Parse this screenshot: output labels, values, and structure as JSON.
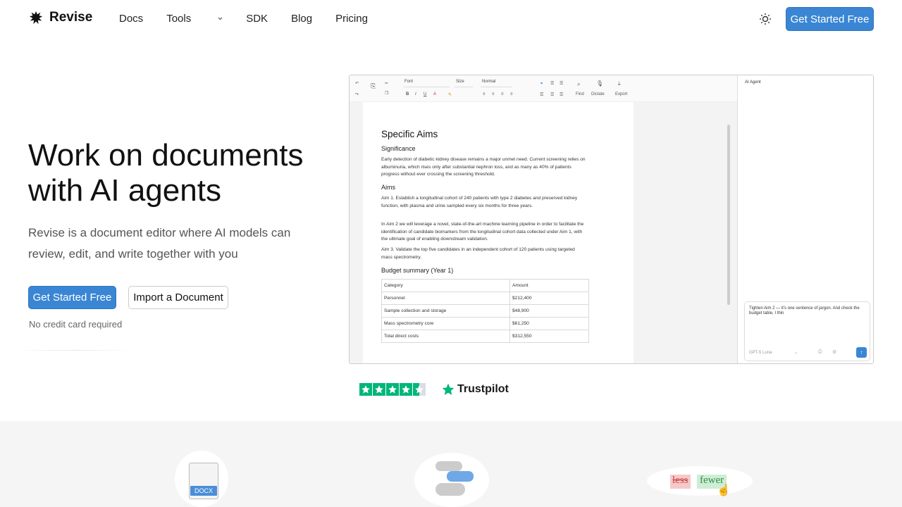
{
  "nav": {
    "brand": "Revise",
    "links": [
      "Docs",
      "Tools",
      "SDK",
      "Blog",
      "Pricing"
    ],
    "cta": "Get Started Free"
  },
  "hero": {
    "title": "Work on documents with AI agents",
    "subtitle": "Revise is a document editor where AI models can review, edit, and write together with you",
    "primary_cta": "Get Started Free",
    "secondary_cta": "Import a Document",
    "note": "No credit card required"
  },
  "editor": {
    "toolbar": {
      "font": "Font",
      "size": "Size",
      "style": "Normal",
      "find": "Find",
      "dictate": "Dictate",
      "export": "Export"
    },
    "doc": {
      "title": "Specific Aims",
      "significance_heading": "Significance",
      "significance_text": "Early detection of diabetic kidney disease remains a major unmet need. Current screening relies on albuminuria, which rises only after substantial nephron loss, and as many as 40% of patients progress without ever crossing the screening threshold.",
      "aims_heading": "Aims",
      "aim1": "Aim 1. Establish a longitudinal cohort of 240 patients with type 2 diabetes and preserved kidney function, with plasma and urine sampled every six months for three years.",
      "aim2": "In Aim 2 we will leverage a novel, state-of-the-art machine learning pipeline in order to facilitate the identification of candidate biomarkers from the longitudinal cohort data collected under Aim 1, with the ultimate goal of enabling downstream validation.",
      "aim3": "Aim 3. Validate the top five candidates in an independent cohort of 120 patients using targeted mass spectrometry.",
      "budget_heading": "Budget summary (Year 1)",
      "budget_table": {
        "headers": [
          "Category",
          "Amount"
        ],
        "rows": [
          [
            "Personnel",
            "$212,400"
          ],
          [
            "Sample collection and storage",
            "$48,900"
          ],
          [
            "Mass spectrometry core",
            "$61,250"
          ],
          [
            "Total direct costs",
            "$312,550"
          ]
        ]
      }
    },
    "sidebar": {
      "title": "AI Agent",
      "prompt": "Tighten Aim 2 — it's one sentence of jargon. And check the budget table, I thin",
      "model": "GPT-5 Luna"
    }
  },
  "trust": {
    "name": "Trustpilot",
    "rating_stars": 4.5
  },
  "features": {
    "docx_label": "DOCX",
    "deleted_word": "less",
    "inserted_word": "fewer"
  },
  "colors": {
    "primary": "#3a86d4",
    "trustpilot_green": "#00b67a"
  }
}
